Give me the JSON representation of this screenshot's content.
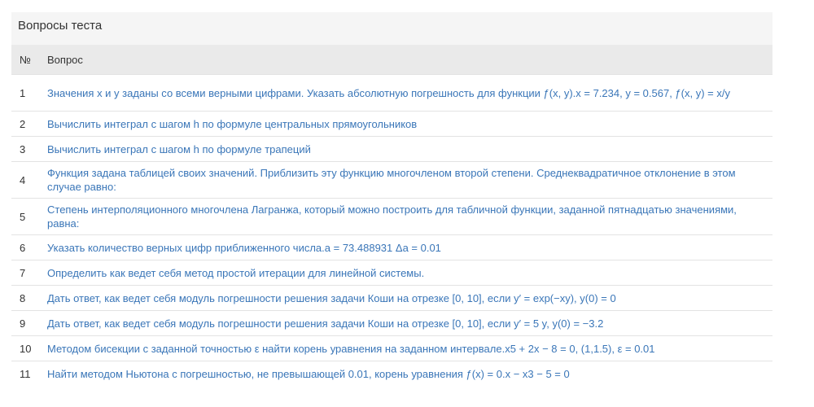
{
  "panel": {
    "title": "Вопросы теста"
  },
  "table": {
    "headers": {
      "number": "№",
      "question": "Вопрос"
    },
    "rows": [
      {
        "number": "1",
        "question": "Значения x и y заданы со всеми верными цифрами. Указать абсолютную погрешность для функции ƒ(x, y).x = 7.234, y = 0.567, ƒ(x, y) = x/y"
      },
      {
        "number": "2",
        "question": "Вычислить интеграл с шагом h по формуле центральных прямоугольников"
      },
      {
        "number": "3",
        "question": "Вычислить интеграл с шагом h по формуле трапеций"
      },
      {
        "number": "4",
        "question": "Функция задана таблицей своих значений. Приблизить эту функцию многочленом второй степени. Среднеквадратичное отклонение в этом случае равно:"
      },
      {
        "number": "5",
        "question": "Степень интерполяционного многочлена Лагранжа, который можно построить для табличной функции, заданной пятнадцатью значениями, равна:"
      },
      {
        "number": "6",
        "question": "Указать количество верных цифр приближенного числа.a = 73.488931 Δa = 0.01"
      },
      {
        "number": "7",
        "question": "Определить как ведет себя метод простой итерации для линейной системы."
      },
      {
        "number": "8",
        "question": "Дать ответ, как ведет себя модуль погрешности решения задачи Коши на отрезке [0, 10], если y′ = exp(−xy), y(0) = 0"
      },
      {
        "number": "9",
        "question": "Дать ответ, как ведет себя модуль погрешности решения задачи Коши на отрезке [0, 10], если y′ = 5 y, y(0) = −3.2"
      },
      {
        "number": "10",
        "question": "Методом бисекции с заданной точностью ε найти корень уравнения на заданном интервале.x5 + 2x − 8 = 0, (1,1.5), ε = 0.01"
      },
      {
        "number": "11",
        "question": "Найти методом Ньютона с погрешностью, не превышающей 0.01, корень уравнения ƒ(x) = 0.x − x3 − 5 = 0"
      }
    ]
  }
}
